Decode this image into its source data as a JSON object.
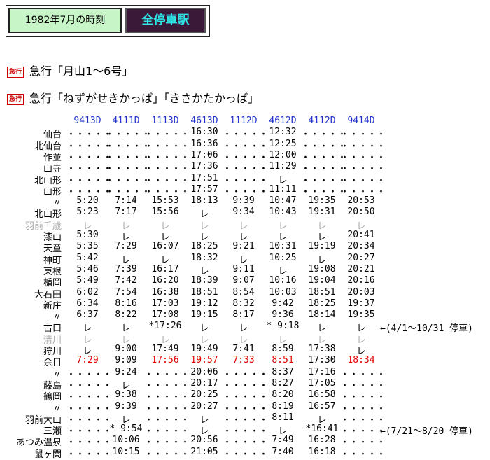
{
  "header": {
    "title": "1982年7月の時刻",
    "button": "全停車駅"
  },
  "lines": [
    {
      "badge": "急行",
      "text": "急行「月山1～6号」"
    },
    {
      "badge": "急行",
      "text": "急行「ねずがせきかっぱ」「きさかたかっぱ」"
    }
  ],
  "trains": [
    "9413D",
    "4111D",
    "1113D",
    "4613D",
    "1112D",
    "4612D",
    "4112D",
    "9414D"
  ],
  "rows": [
    {
      "st": "仙台",
      "v": [
        "・・・・・",
        "・・・・・",
        "・・・・・",
        "16:30",
        "・・・・・",
        "12:32",
        "・・・・・",
        "・・・・・"
      ]
    },
    {
      "st": "北仙台",
      "v": [
        "・・・・・",
        "・・・・・",
        "・・・・・",
        "16:36",
        "・・・・・",
        "12:25",
        "・・・・・",
        "・・・・・"
      ]
    },
    {
      "st": "作並",
      "v": [
        "・・・・・",
        "・・・・・",
        "・・・・・",
        "17:06",
        "・・・・・",
        "12:00",
        "・・・・・",
        "・・・・・"
      ]
    },
    {
      "st": "山寺",
      "v": [
        "・・・・・",
        "・・・・・",
        "・・・・・",
        "17:36",
        "・・・・・",
        "11:29",
        "・・・・・",
        "・・・・・"
      ]
    },
    {
      "st": "北山形",
      "v": [
        "・・・・・",
        "・・・・・",
        "・・・・・",
        "17:51",
        "・・・・・",
        "レ",
        "・・・・・",
        "・・・・・"
      ]
    },
    {
      "st": "山形",
      "v": [
        "・・・・・",
        "・・・・・",
        "・・・・・",
        "17:57",
        "・・・・・",
        "11:11",
        "・・・・・",
        "・・・・・"
      ]
    },
    {
      "st": "〃",
      "v": [
        "5:20",
        "7:14",
        "15:53",
        "18:13",
        "9:39",
        "10:47",
        "19:35",
        "20:53"
      ]
    },
    {
      "st": "北山形",
      "v": [
        "5:23",
        "7:17",
        "15:56",
        "レ",
        "9:34",
        "10:43",
        "19:31",
        "20:50"
      ]
    },
    {
      "st": "羽前千歳",
      "gray": true,
      "v": [
        "レ",
        "レ",
        "レ",
        "レ",
        "レ",
        "レ",
        "レ",
        "レ"
      ]
    },
    {
      "st": "漆山",
      "v": [
        "5:30",
        "レ",
        "レ",
        "レ",
        "レ",
        "レ",
        "レ",
        "20:41"
      ]
    },
    {
      "st": "天童",
      "v": [
        "5:35",
        "7:29",
        "16:07",
        "18:25",
        "9:21",
        "10:31",
        "19:19",
        "20:34"
      ]
    },
    {
      "st": "神町",
      "v": [
        "5:42",
        "レ",
        "レ",
        "18:32",
        "レ",
        "10:25",
        "レ",
        "20:27"
      ]
    },
    {
      "st": "東根",
      "v": [
        "5:46",
        "7:39",
        "16:17",
        "レ",
        "9:11",
        "レ",
        "19:08",
        "20:21"
      ]
    },
    {
      "st": "楯岡",
      "v": [
        "5:49",
        "7:42",
        "16:20",
        "18:39",
        "9:07",
        "10:16",
        "19:04",
        "20:16"
      ]
    },
    {
      "st": "大石田",
      "v": [
        "6:02",
        "7:54",
        "16:38",
        "18:51",
        "8:54",
        "10:03",
        "18:51",
        "20:03"
      ]
    },
    {
      "st": "新庄",
      "v": [
        "6:34",
        "8:16",
        "17:03",
        "19:12",
        "8:32",
        "9:42",
        "18:25",
        "19:37"
      ]
    },
    {
      "st": "〃",
      "v": [
        "6:37",
        "8:22",
        "17:08",
        "19:15",
        "8:17",
        "9:36",
        "18:14",
        "19:35"
      ]
    },
    {
      "st": "古口",
      "v": [
        "レ",
        "レ",
        "*17:26",
        "レ",
        "レ",
        "* 9:18",
        "レ",
        "レ"
      ],
      "note": "←(4/1～10/31 停車)"
    },
    {
      "st": "清川",
      "gray": true,
      "v": [
        "レ",
        "レ",
        "レ",
        "レ",
        "レ",
        "レ",
        "レ",
        "レ"
      ]
    },
    {
      "st": "狩川",
      "v": [
        "レ",
        "9:00",
        "17:49",
        "19:49",
        "7:41",
        "8:59",
        "17:38",
        "レ"
      ]
    },
    {
      "st": "余目",
      "red": true,
      "v": [
        "7:29",
        "9:09",
        "17:56",
        "19:57",
        "7:33",
        "8:51",
        "17:30",
        "18:34"
      ]
    },
    {
      "st": "〃",
      "v": [
        "・・・・・",
        "9:24",
        "・・・・・",
        "20:06",
        "・・・・・",
        "8:37",
        "17:16",
        "・・・・・"
      ]
    },
    {
      "st": "藤島",
      "v": [
        "・・・・・",
        "レ",
        "・・・・・",
        "20:17",
        "・・・・・",
        "8:27",
        "17:05",
        "・・・・・"
      ]
    },
    {
      "st": "鶴岡",
      "v": [
        "・・・・・",
        "9:38",
        "・・・・・",
        "20:25",
        "・・・・・",
        "8:20",
        "16:58",
        "・・・・・"
      ]
    },
    {
      "st": "〃",
      "v": [
        "・・・・・",
        "9:39",
        "・・・・・",
        "20:27",
        "・・・・・",
        "8:19",
        "16:57",
        "・・・・・"
      ]
    },
    {
      "st": "羽前大山",
      "v": [
        "・・・・・",
        "レ",
        "・・・・・",
        "レ",
        "・・・・・",
        "8:11",
        "レ",
        "・・・・・"
      ]
    },
    {
      "st": "三瀬",
      "v": [
        "・・・・・",
        "* 9:54",
        "・・・・・",
        "レ",
        "・・・・・",
        "レ",
        "*16:41",
        "・・・・・"
      ],
      "note": "←(7/21～8/20 停車)"
    },
    {
      "st": "あつみ温泉",
      "v": [
        "・・・・・",
        "10:06",
        "・・・・・",
        "20:56",
        "・・・・・",
        "7:49",
        "16:28",
        "・・・・・"
      ]
    },
    {
      "st": "鼠ヶ関",
      "v": [
        "・・・・・",
        "10:15",
        "・・・・・",
        "21:05",
        "・・・・・",
        "7:40",
        "16:18",
        "・・・・・"
      ]
    }
  ],
  "redCols": [
    0,
    2,
    3,
    4,
    5,
    7
  ]
}
